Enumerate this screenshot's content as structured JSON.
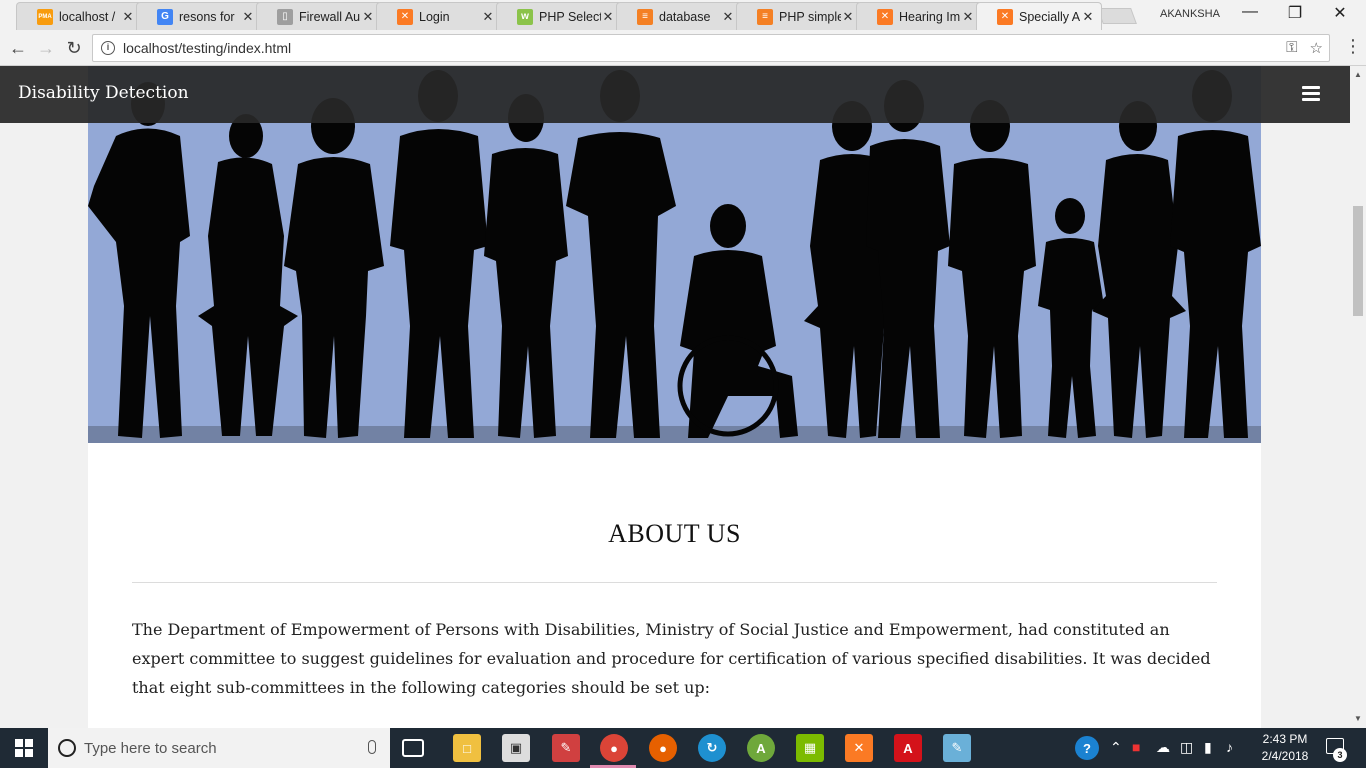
{
  "browser": {
    "tabs": [
      {
        "label": "localhost /",
        "icon": "phpmyadmin-icon",
        "color": "#f89c0e",
        "glyph": "PMA"
      },
      {
        "label": "resons for",
        "icon": "google-icon",
        "color": "#4285f4",
        "glyph": "G"
      },
      {
        "label": "Firewall Au",
        "icon": "document-icon",
        "color": "#9e9e9e",
        "glyph": "▯"
      },
      {
        "label": "Login",
        "icon": "xampp-icon",
        "color": "#fb7a24",
        "glyph": "✕"
      },
      {
        "label": "PHP Select",
        "icon": "php-icon",
        "color": "#8bc34a",
        "glyph": "w"
      },
      {
        "label": "database",
        "icon": "stackoverflow-icon",
        "color": "#f48024",
        "glyph": "≡"
      },
      {
        "label": "PHP simple",
        "icon": "stackoverflow-icon",
        "color": "#f48024",
        "glyph": "≡"
      },
      {
        "label": "Hearing Im",
        "icon": "xampp-icon",
        "color": "#fb7a24",
        "glyph": "✕"
      },
      {
        "label": "Specially A",
        "icon": "xampp-icon",
        "color": "#fb7a24",
        "glyph": "✕",
        "active": true
      }
    ],
    "profile_name": "AKANKSHA",
    "url": "localhost/testing/index.html"
  },
  "site": {
    "brand": "Disability Detection",
    "about_title": "ABOUT US",
    "about_text": "The Department of Empowerment of Persons with Disabilities, Ministry of Social Justice and Empowerment, had constituted an expert committee to suggest guidelines for evaluation and procedure for certification of various specified disabilities. It was decided that eight sub-committees in the following categories should be set up:",
    "hero_bg_color": "#93a8d6"
  },
  "taskbar": {
    "search_placeholder": "Type here to search",
    "time": "2:43 PM",
    "date": "2/4/2018",
    "notification_count": "3"
  }
}
